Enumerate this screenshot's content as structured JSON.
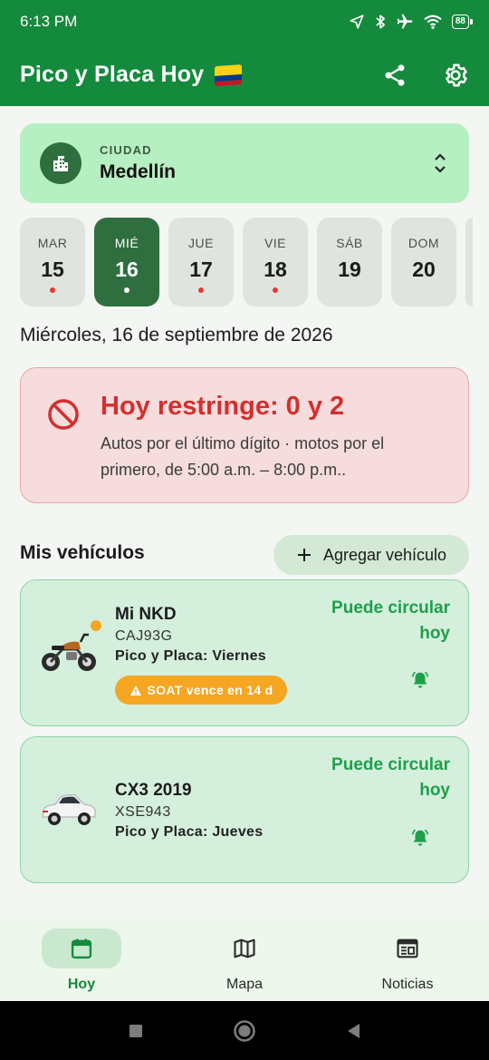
{
  "status_bar": {
    "time": "6:13 PM",
    "battery": "88"
  },
  "app_bar": {
    "title": "Pico y Placa Hoy"
  },
  "city": {
    "label": "CIUDAD",
    "value": "Medellín"
  },
  "days": [
    {
      "name": "MAR",
      "num": "15",
      "restricted": true,
      "selected": false
    },
    {
      "name": "MIÉ",
      "num": "16",
      "restricted": false,
      "selected": true
    },
    {
      "name": "JUE",
      "num": "17",
      "restricted": true,
      "selected": false
    },
    {
      "name": "VIE",
      "num": "18",
      "restricted": true,
      "selected": false
    },
    {
      "name": "SÁB",
      "num": "19",
      "restricted": false,
      "selected": false
    },
    {
      "name": "DOM",
      "num": "20",
      "restricted": false,
      "selected": false
    }
  ],
  "date_heading": "Miércoles, 16 de septiembre de 2026",
  "restriction": {
    "title": "Hoy restringe: 0 y 2",
    "description": "Autos por el último dígito · motos por el primero, de 5:00 a.m. – 8:00 p.m.."
  },
  "vehicles_section": {
    "heading": "Mis vehículos",
    "add_label": "Agregar vehículo"
  },
  "vehicles": [
    {
      "name": "Mi NKD",
      "plate": "CAJ93G",
      "pico_placa": "Pico y Placa: Viernes",
      "status": "Puede circular hoy",
      "badge": "SOAT vence en 14 d",
      "type": "motorcycle"
    },
    {
      "name": "CX3 2019",
      "plate": "XSE943",
      "pico_placa": "Pico y Placa: Jueves",
      "status": "Puede circular hoy",
      "type": "car"
    }
  ],
  "bottom_nav": [
    {
      "label": "Hoy",
      "icon": "calendar-icon",
      "active": true
    },
    {
      "label": "Mapa",
      "icon": "map-icon",
      "active": false
    },
    {
      "label": "Noticias",
      "icon": "newspaper-icon",
      "active": false
    }
  ],
  "colors": {
    "primary": "#148a3c",
    "restrict": "#d32f2f",
    "ok": "#1ea04a",
    "warning": "#f5a623"
  }
}
